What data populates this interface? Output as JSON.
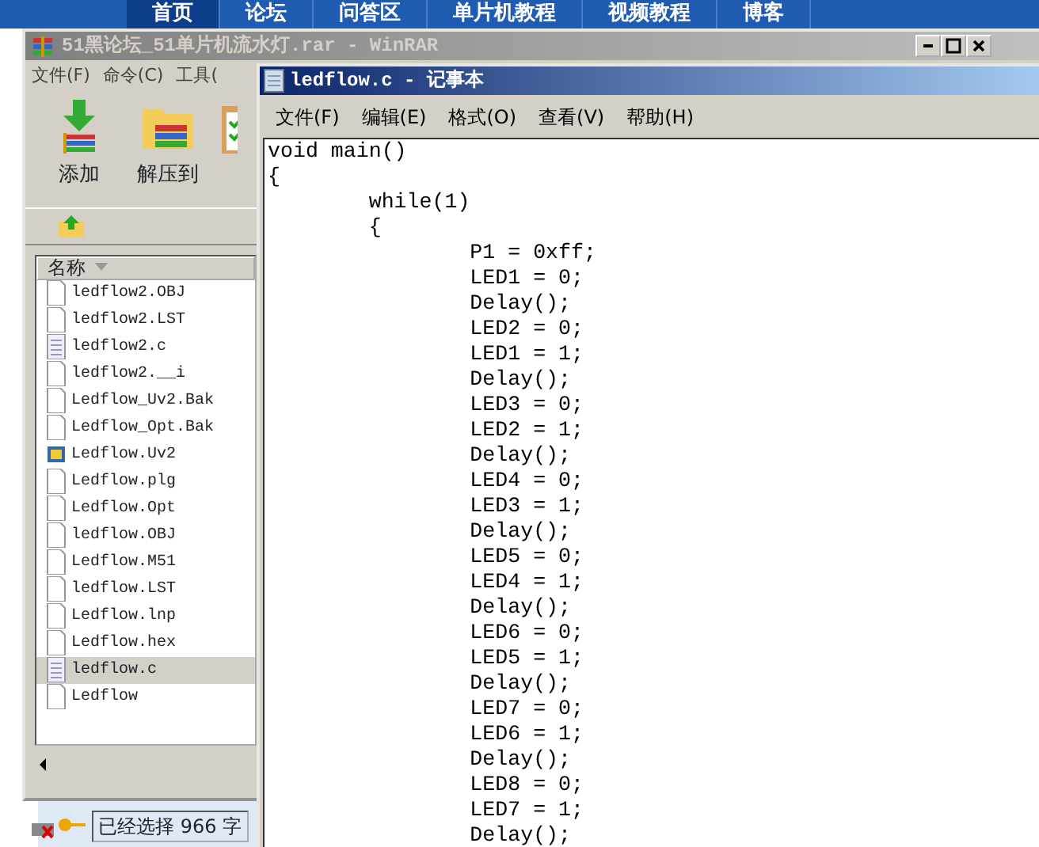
{
  "site_nav": {
    "items": [
      {
        "label": "首页",
        "selected": true
      },
      {
        "label": "论坛",
        "selected": false
      },
      {
        "label": "问答区",
        "selected": false
      },
      {
        "label": "单片机教程",
        "selected": false
      },
      {
        "label": "视频教程",
        "selected": false
      },
      {
        "label": "博客",
        "selected": false
      }
    ]
  },
  "archive_window": {
    "title": "51黑论坛_51单片机流水灯.rar - WinRAR",
    "active": false,
    "menu": [
      "文件(F)",
      "命令(C)",
      "工具("
    ],
    "toolbar": [
      {
        "kind": "add",
        "label": "添加"
      },
      {
        "kind": "extract",
        "label": "解压到"
      },
      {
        "kind": "test"
      }
    ],
    "file_list": {
      "columns": [
        "名称"
      ],
      "rows": [
        {
          "name": "ledflow2.OBJ",
          "kind": "blank",
          "selected": false
        },
        {
          "name": "ledflow2.LST",
          "kind": "blank",
          "selected": false
        },
        {
          "name": "ledflow2.c",
          "kind": "text",
          "selected": false
        },
        {
          "name": "ledflow2.__i",
          "kind": "blank",
          "selected": false
        },
        {
          "name": "Ledflow_Uv2.Bak",
          "kind": "blank",
          "selected": false
        },
        {
          "name": "Ledflow_Opt.Bak",
          "kind": "blank",
          "selected": false
        },
        {
          "name": "Ledflow.Uv2",
          "kind": "project",
          "selected": false
        },
        {
          "name": "Ledflow.plg",
          "kind": "blank",
          "selected": false
        },
        {
          "name": "Ledflow.Opt",
          "kind": "blank",
          "selected": false
        },
        {
          "name": "ledflow.OBJ",
          "kind": "blank",
          "selected": false
        },
        {
          "name": "Ledflow.M51",
          "kind": "blank",
          "selected": false
        },
        {
          "name": "ledflow.LST",
          "kind": "blank",
          "selected": false
        },
        {
          "name": "Ledflow.lnp",
          "kind": "blank",
          "selected": false
        },
        {
          "name": "Ledflow.hex",
          "kind": "blank",
          "selected": false
        },
        {
          "name": "ledflow.c",
          "kind": "text",
          "selected": true
        },
        {
          "name": "Ledflow",
          "kind": "blank",
          "selected": false
        }
      ]
    },
    "status_bar": "已经选择 966 字"
  },
  "editor_window": {
    "title": "ledflow.c - 记事本",
    "active": true,
    "menu": [
      "文件(F)",
      "编辑(E)",
      "格式(O)",
      "查看(V)",
      "帮助(H)"
    ],
    "lines": [
      "void main()",
      "{",
      "\twhile(1)",
      "\t{",
      "\t\tP1 = 0xff;",
      "\t\tLED1 = 0;",
      "\t\tDelay();",
      "\t\tLED2 = 0;",
      "\t\tLED1 = 1;",
      "\t\tDelay();",
      "\t\tLED3 = 0;",
      "\t\tLED2 = 1;",
      "\t\tDelay();",
      "\t\tLED4 = 0;",
      "\t\tLED3 = 1;",
      "\t\tDelay();",
      "\t\tLED5 = 0;",
      "\t\tLED4 = 1;",
      "\t\tDelay();",
      "\t\tLED6 = 0;",
      "\t\tLED5 = 1;",
      "\t\tDelay();",
      "\t\tLED7 = 0;",
      "\t\tLED6 = 1;",
      "\t\tDelay();",
      "\t\tLED8 = 0;",
      "\t\tLED7 = 1;",
      "\t\tDelay();"
    ]
  }
}
